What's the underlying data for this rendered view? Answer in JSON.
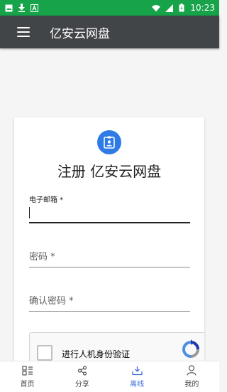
{
  "status_bar": {
    "time": "10:23",
    "left_icons": [
      "image-icon",
      "download-icon",
      "a-icon"
    ],
    "right_icons": [
      "wifi-icon",
      "signal-icon",
      "battery-icon"
    ]
  },
  "app_bar": {
    "title": "亿安云网盘",
    "menu_icon": "hamburger-menu-icon"
  },
  "register_card": {
    "badge_icon": "contact-id-icon",
    "heading": "注册 亿安云网盘",
    "email": {
      "label": "电子邮箱 *",
      "value": ""
    },
    "password": {
      "placeholder": "密码 *"
    },
    "confirm_password": {
      "placeholder": "确认密码 *"
    },
    "recaptcha": {
      "label": "进行人机身份验证",
      "logo": "recaptcha-logo"
    }
  },
  "bottom_nav": {
    "active": "离线",
    "items": [
      {
        "label": "首页",
        "icon": "home-grid-icon"
      },
      {
        "label": "分享",
        "icon": "share-icon"
      },
      {
        "label": "离线",
        "icon": "download-tray-icon"
      },
      {
        "label": "我的",
        "icon": "person-icon"
      }
    ]
  },
  "colors": {
    "status_bar": "#17a34a",
    "app_bar": "#424548",
    "accent": "#2f7be6",
    "active_nav": "#3f6fd8"
  }
}
